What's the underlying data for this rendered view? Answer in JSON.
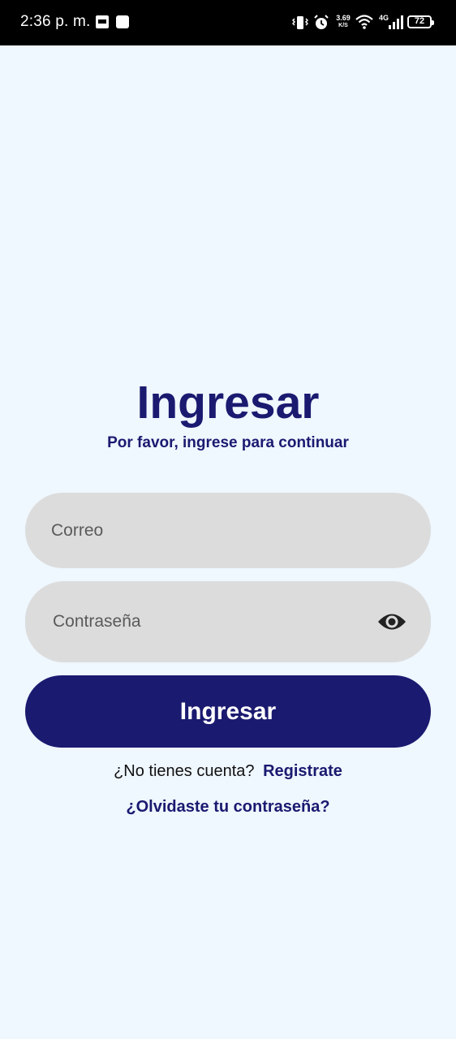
{
  "status_bar": {
    "time": "2:36 p. m.",
    "speed_value": "3.69",
    "speed_unit": "K/S",
    "network": "4G",
    "battery": "72",
    "icons": [
      "notification-icon",
      "notification-icon",
      "vibrate-icon",
      "alarm-icon",
      "wifi-icon",
      "signal-icon",
      "battery-icon"
    ]
  },
  "login": {
    "title": "Ingresar",
    "subtitle": "Por favor, ingrese para continuar",
    "email_placeholder": "Correo",
    "email_value": "",
    "password_placeholder": "Contraseña",
    "password_value": "",
    "submit_label": "Ingresar",
    "no_account_text": "¿No tienes cuenta?",
    "register_label": "Registrate",
    "forgot_label": "¿Olvidaste tu contraseña?"
  },
  "colors": {
    "background": "#eff7ff",
    "primary": "#1a1a70",
    "field": "#dcdcdc"
  }
}
